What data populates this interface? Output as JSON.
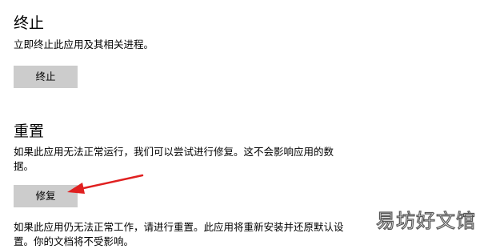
{
  "terminate": {
    "title": "终止",
    "description": "立即终止此应用及其相关进程。",
    "button_label": "终止"
  },
  "reset": {
    "title": "重置",
    "repair_description": "如果此应用无法正常运行，我们可以尝试进行修复。这不会影响应用的数据。",
    "repair_button_label": "修复",
    "reset_description": "如果此应用仍无法正常工作，请进行重置。此应用将重新安装并还原默认设置。你的文档将不受影响。"
  },
  "watermark": {
    "text": "易坊好文馆"
  },
  "annotation": {
    "arrow_color": "#e02020"
  }
}
